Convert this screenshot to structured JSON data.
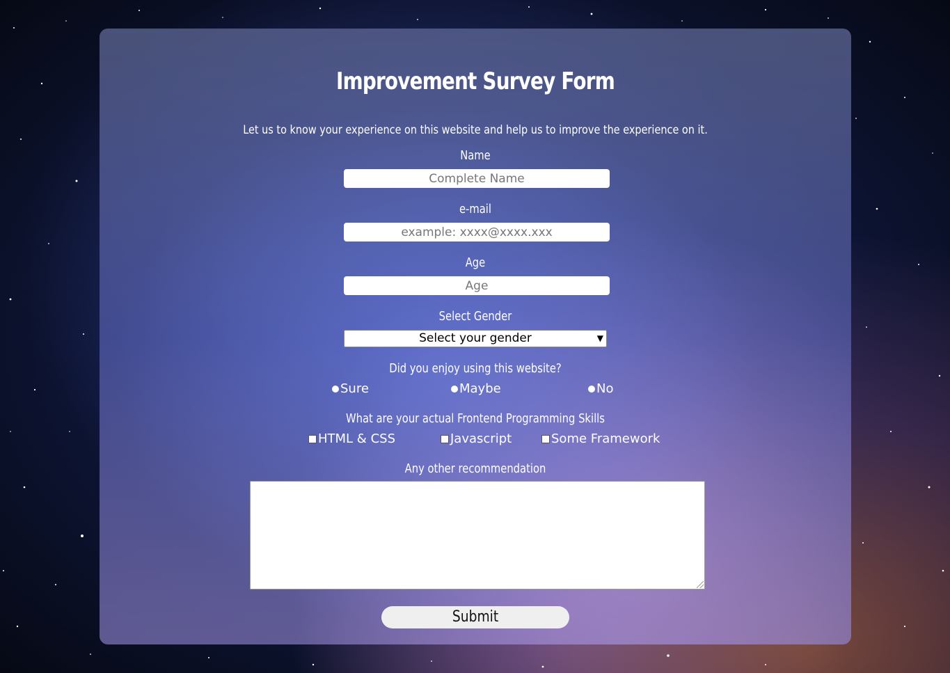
{
  "form": {
    "title": "Improvement Survey Form",
    "description": "Let us to know your experience on this website and help us to improve the experience on it.",
    "name": {
      "label": "Name",
      "placeholder": "Complete Name",
      "value": ""
    },
    "email": {
      "label": "e-mail",
      "placeholder": "example: xxxx@xxxx.xxx",
      "value": ""
    },
    "age": {
      "label": "Age",
      "placeholder": "Age",
      "value": ""
    },
    "gender": {
      "label": "Select Gender",
      "selected": "Select your gender"
    },
    "enjoy": {
      "question": "Did you enjoy using this website?",
      "options": [
        "Sure",
        "Maybe",
        "No"
      ]
    },
    "skills": {
      "question": "What are your actual Frontend Programming Skills",
      "options": [
        "HTML & CSS",
        "Javascript",
        "Some Framework"
      ]
    },
    "recommendation": {
      "label": "Any other recommendation",
      "value": ""
    },
    "submit_label": "Submit"
  },
  "icons": {
    "select_arrow": "chevron-down-icon"
  }
}
